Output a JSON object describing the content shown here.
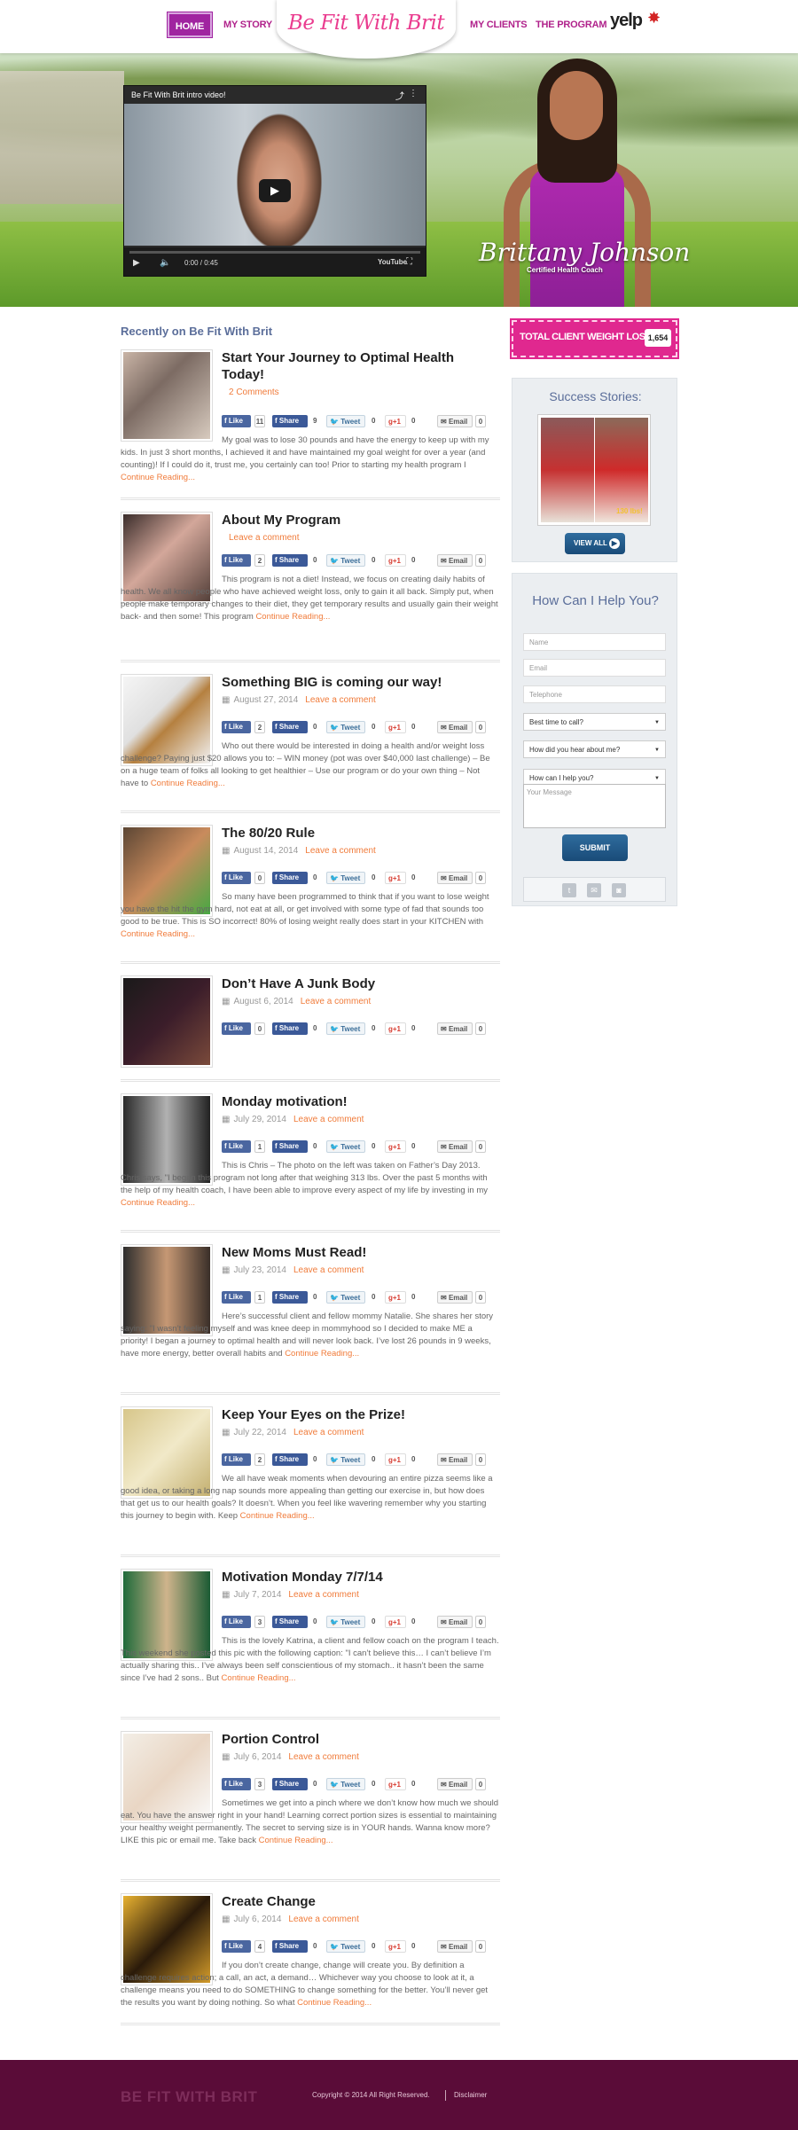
{
  "nav": {
    "home": "HOME",
    "my_story": "MY STORY",
    "logo": "Be Fit With Brit",
    "my_clients": "MY CLIENTS",
    "the_program": "THE PROGRAM",
    "yelp": "yelp"
  },
  "hero": {
    "video_title": "Be Fit With Brit intro video!",
    "video_time": "0:00 / 0:45",
    "video_brand": "YouTube",
    "name": "Brittany Johnson",
    "credential": "Certified Health Coach"
  },
  "main": {
    "heading": "Recently on Be Fit With Brit"
  },
  "social": {
    "like": "Like",
    "share": "Share",
    "tweet": "Tweet",
    "gplus": "g+1",
    "email": "Email"
  },
  "posts": [
    {
      "title": "Start Your Journey to Optimal Health Today!",
      "date": "",
      "comments": "2 Comments",
      "likes": "11",
      "shares": "9",
      "tweets": "0",
      "gplus": "0",
      "emails": "0",
      "excerpt_lead": "My goal was to lose 30 pounds and have the energy to keep up with",
      "excerpt_rest": "my kids. In just 3 short months, I achieved it and have maintained my goal weight for over a year (and counting)! If I could do it, trust me, you certainly can too! Prior to starting my health program I",
      "read_more": "Continue Reading..."
    },
    {
      "title": "About My Program",
      "date": "",
      "comments": "Leave a comment",
      "likes": "2",
      "shares": "0",
      "tweets": "0",
      "gplus": "0",
      "emails": "0",
      "excerpt_lead": "This program is not a diet! Instead, we focus on creating daily habits of health. We all know people who have achieved weight loss, only to gain it all back. Simply put, when people make temporary changes to",
      "excerpt_rest": "their diet, they get temporary results and usually gain their weight back- and then some! This program",
      "read_more": "Continue Reading..."
    },
    {
      "title": "Something BIG is coming our way!",
      "date": "August 27, 2014",
      "comments": "Leave a comment",
      "likes": "2",
      "shares": "0",
      "tweets": "0",
      "gplus": "0",
      "emails": "0",
      "excerpt_lead": "Who out there would be interested in doing a health and/or weight loss challenge? Paying just $20 allows you to: – WIN money (pot was over $40,000 last challenge) – Be on a huge team of folks all looking to",
      "excerpt_rest": "get healthier – Use our program or do your own thing – Not have to",
      "read_more": "Continue Reading..."
    },
    {
      "title": "The 80/20 Rule",
      "date": "August 14, 2014",
      "comments": "Leave a comment",
      "likes": "0",
      "shares": "0",
      "tweets": "0",
      "gplus": "0",
      "emails": "0",
      "excerpt_lead": "So many have been programmed to think that if you want to lose weight you have the hit the gym hard, not eat at all, or get involved with some type of fad that sounds too good to be true. This is SO",
      "excerpt_rest": "incorrect! 80% of losing weight really does start in your KITCHEN with",
      "read_more": "Continue Reading..."
    },
    {
      "title": "Don’t Have A Junk Body",
      "date": "August 6, 2014",
      "comments": "Leave a comment",
      "likes": "0",
      "shares": "0",
      "tweets": "0",
      "gplus": "0",
      "emails": "0",
      "excerpt_lead": "",
      "excerpt_rest": "",
      "read_more": ""
    },
    {
      "title": "Monday motivation!",
      "date": "July 29, 2014",
      "comments": "Leave a comment",
      "likes": "1",
      "shares": "0",
      "tweets": "0",
      "gplus": "0",
      "emails": "0",
      "excerpt_lead": "This is Chris – The photo on the left was taken on Father’s Day 2013. Chris says, \"I began this program not long after that weighing 313 lbs. Over the past 5 months with the help of my health coach, I have been",
      "excerpt_rest": "able to improve every aspect of my life by investing in my",
      "read_more": "Continue Reading..."
    },
    {
      "title": "New Moms Must Read!",
      "date": "July 23, 2014",
      "comments": "Leave a comment",
      "likes": "1",
      "shares": "0",
      "tweets": "0",
      "gplus": "0",
      "emails": "0",
      "excerpt_lead": "Here’s successful client and fellow mommy Natalie. She shares her story saying: \"I wasn’t feeling myself and was knee deep in mommyhood so I decided to make ME a priority! I began a journey to",
      "excerpt_rest": "optimal health and will never look back. I’ve lost 26 pounds in 9 weeks, have more energy, better overall habits and",
      "read_more": "Continue Reading..."
    },
    {
      "title": "Keep Your Eyes on the Prize!",
      "date": "July 22, 2014",
      "comments": "Leave a comment",
      "likes": "2",
      "shares": "0",
      "tweets": "0",
      "gplus": "0",
      "emails": "0",
      "excerpt_lead": "We all have weak moments when devouring an entire pizza seems like a good idea, or taking a long nap sounds more appealing than getting our exercise in, but how does that get us to our health goals?",
      "excerpt_rest": "It doesn’t. When you feel like wavering remember why you starting this journey to begin with. Keep",
      "read_more": "Continue Reading..."
    },
    {
      "title": "Motivation Monday 7/7/14",
      "date": "July 7, 2014",
      "comments": "Leave a comment",
      "likes": "3",
      "shares": "0",
      "tweets": "0",
      "gplus": "0",
      "emails": "0",
      "excerpt_lead": "This is the lovely Katrina, a client and fellow coach on the program I teach. This weekend she posted this pic with the following caption: \"I can’t believe this… I can’t believe I’m actually sharing this.. I’ve always",
      "excerpt_rest": "been self conscientious of my stomach.. it hasn’t been the same since I’ve had 2 sons.. But",
      "read_more": "Continue Reading..."
    },
    {
      "title": "Portion Control",
      "date": "July 6, 2014",
      "comments": "Leave a comment",
      "likes": "3",
      "shares": "0",
      "tweets": "0",
      "gplus": "0",
      "emails": "0",
      "excerpt_lead": "Sometimes we get into a pinch where we don’t know how much we should eat. You have the answer right in your hand! Learning correct portion sizes is essential to maintaining your healthy weight",
      "excerpt_rest": "permanently. The secret to serving size is in YOUR hands. Wanna know more? LIKE this pic or email me. Take back",
      "read_more": "Continue Reading..."
    },
    {
      "title": "Create Change",
      "date": "July 6, 2014",
      "comments": "Leave a comment",
      "likes": "4",
      "shares": "0",
      "tweets": "0",
      "gplus": "0",
      "emails": "0",
      "excerpt_lead": "If you don’t create change, change will create you. By definition a challenge requires action; a call, an act, a demand… Whichever way you choose to look at it, a challenge means you need to do",
      "excerpt_rest": "SOMETHING to change something for the better. You’ll never get the results you want by doing nothing.  So what",
      "read_more": "Continue Reading..."
    }
  ],
  "sidebar": {
    "weight_label": "TOTAL CLIENT WEIGHT LOSS!",
    "weight_count": "1,654",
    "success_title": "Success Stories:",
    "success_lbs": "130 lbs!",
    "view_all": "VIEW ALL",
    "help_title": "How Can I Help You?",
    "name_placeholder": "Name",
    "email_placeholder": "Email",
    "phone_placeholder": "Telephone",
    "select_call": "Best time to call?",
    "select_hear": "How did you hear about me?",
    "select_help": "How can I help you?",
    "message_placeholder": "Your Message",
    "submit": "SUBMIT"
  },
  "footer": {
    "logo": "BE FIT WITH BRIT",
    "copyright": "Copyright © 2014 All Right Reserved.",
    "disclaimer": "Disclaimer"
  },
  "colors": {
    "accent": "#a024a0",
    "pink": "#e0288f",
    "link": "#f07b3a",
    "footer": "#5a0c38",
    "heading": "#5b6e9a"
  }
}
